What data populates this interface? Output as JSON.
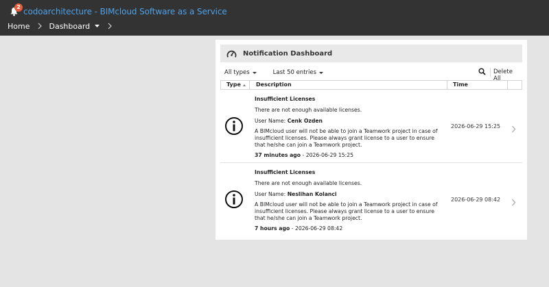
{
  "header": {
    "app_title": "codoarchitecture - BIMcloud Software as a Service",
    "notification_count": "2",
    "nav": {
      "home": "Home",
      "dashboard": "Dashboard"
    }
  },
  "panel": {
    "title": "Notification Dashboard",
    "filters": {
      "type": "All types",
      "range": "Last 50 entries"
    },
    "delete_all": "Delete All",
    "columns": {
      "type": "Type",
      "description": "Description",
      "time": "Time"
    }
  },
  "notifications": [
    {
      "title": "Insufficient Licenses",
      "message": "There are not enough available licenses.",
      "user_label": "User Name:",
      "user_name": "Cenk Ozden",
      "body": "A BIMcloud user will not be able to join a Teamwork project in case of insufficient licenses. Please always grant license to a user to ensure that he/she can join a Teamwork project.",
      "age": "37 minutes ago",
      "age_suffix": " - 2026-06-29 15:25",
      "time": "2026-06-29 15:25"
    },
    {
      "title": "Insufficient Licenses",
      "message": "There are not enough available licenses.",
      "user_label": "User Name:",
      "user_name": "Neslihan Kolanci",
      "body": "A BIMcloud user will not be able to join a Teamwork project in case of insufficient licenses. Please always grant license to a user to ensure that he/she can join a Teamwork project.",
      "age": "7 hours ago",
      "age_suffix": " - 2026-06-29 08:42",
      "time": "2026-06-29 08:42"
    }
  ],
  "icons": {
    "bell": "bell-icon",
    "breadcrumb_separator": "chevron-right-icon",
    "dashboard_menu": "caret-down-icon",
    "panel": "gauge-icon",
    "search": "search-icon",
    "notification_type": "info-icon",
    "row_action": "chevron-right-icon"
  },
  "colors": {
    "topbar": "#333333",
    "app_title": "#4ea2e8",
    "badge": "#e85a3c",
    "page_bg": "#e4e4e4",
    "panel_header": "#e9e9e9"
  }
}
